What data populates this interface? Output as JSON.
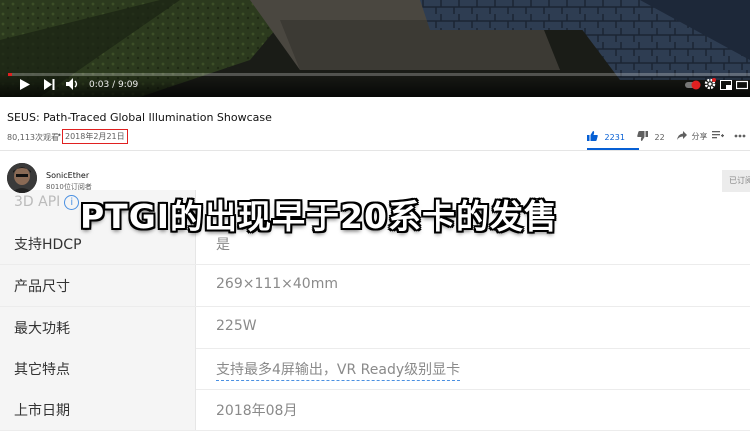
{
  "video": {
    "timecode": "0:03 / 9:09",
    "progress_fraction": 0.006,
    "accent_color": "#e02020"
  },
  "info": {
    "title": "SEUS: Path-Traced Global Illumination Showcase",
    "views": "80,113次观看",
    "separator": "•",
    "date": "2018年2月21日"
  },
  "actions": {
    "likes": "2231",
    "dislikes": "22",
    "share": "分享"
  },
  "channel": {
    "name": "SonicEther",
    "subscribers": "8010位订阅者",
    "subscribe_label": "已订阅"
  },
  "spec_table": {
    "partial_row": {
      "key": "3D API",
      "value": ""
    },
    "rows": [
      {
        "key": "支持HDCP",
        "value": "是",
        "link": false
      },
      {
        "key": "产品尺寸",
        "value": "269×111×40mm",
        "link": false
      },
      {
        "key": "最大功耗",
        "value": "225W",
        "link": false
      },
      {
        "key": "其它特点",
        "value": "支持最多4屏输出，VR Ready级别显卡",
        "link": true
      },
      {
        "key": "上市日期",
        "value": "2018年08月",
        "link": false
      }
    ]
  },
  "subtitle": {
    "text": "PTGI的出现早于20系卡的发售"
  }
}
